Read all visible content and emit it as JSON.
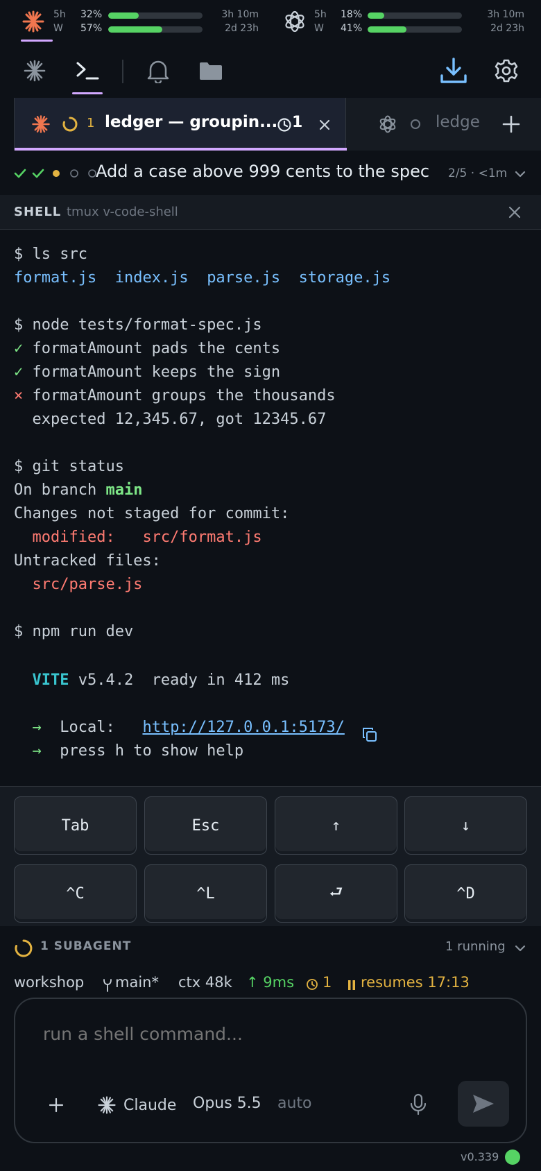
{
  "usage": {
    "claude": {
      "icon": "claude-burst-icon",
      "rows": [
        {
          "label": "5h",
          "pct": "32%",
          "fill": 0.32,
          "time": "3h 10m"
        },
        {
          "label": "W",
          "pct": "57%",
          "fill": 0.57,
          "time": "2d 23h"
        }
      ]
    },
    "openai": {
      "icon": "openai-knot-icon",
      "rows": [
        {
          "label": "5h",
          "pct": "18%",
          "fill": 0.18,
          "time": "3h 10m"
        },
        {
          "label": "W",
          "pct": "41%",
          "fill": 0.41,
          "time": "2d 23h"
        }
      ]
    }
  },
  "toolbar": {
    "left": [
      "claude-burst-icon",
      "terminal-icon",
      "bell-icon",
      "folder-icon"
    ],
    "right": [
      "download-icon",
      "gear-icon"
    ]
  },
  "tabs": [
    {
      "agent_icon": "claude-burst-icon",
      "status_icon": "spinner-icon",
      "count": "1",
      "title": "ledger — groupin...",
      "timer_count": "1"
    },
    {
      "agent_icon": "openai-knot-icon",
      "status_icon": "circle-icon",
      "title": "ledge"
    }
  ],
  "progress": {
    "task": "Add a case above 999 cents to the spec",
    "meta": "2/5 · <1m",
    "steps": [
      "done",
      "done",
      "active",
      "pending",
      "pending"
    ]
  },
  "shell": {
    "title": "SHELL",
    "subtitle": "tmux v-code-shell"
  },
  "terminal": {
    "cmd1": "$ ls src",
    "files": [
      "format.js",
      "index.js",
      "parse.js",
      "storage.js"
    ],
    "cmd2": "$ node tests/format-spec.js",
    "test_pass_mark": "✓",
    "test_fail_mark": "×",
    "tests": [
      {
        "mark": "✓",
        "text": "formatAmount pads the cents"
      },
      {
        "mark": "✓",
        "text": "formatAmount keeps the sign"
      },
      {
        "mark": "×",
        "text": "formatAmount groups the thousands"
      }
    ],
    "test_detail": "  expected 12,345.67, got 12345.67",
    "cmd3": "$ git status",
    "branch_prefix": "On branch ",
    "branch": "main",
    "changes_header": "Changes not staged for commit:",
    "modified_label": "  modified:   ",
    "modified_file": "src/format.js",
    "untracked_header": "Untracked files:",
    "untracked_file": "  src/parse.js",
    "cmd4": "$ npm run dev",
    "vite_name": "  VITE",
    "vite_rest": " v5.4.2  ready in 412 ms",
    "arrow": "  →",
    "local_label": "  Local:   ",
    "local_url": "http://127.0.0.1:5173/",
    "help_text": "  press h to show help"
  },
  "keys": [
    "Tab",
    "Esc",
    "↑",
    "↓",
    "^C",
    "^L",
    "⮐",
    "^D"
  ],
  "subagent": {
    "label": "1 SUBAGENT",
    "running": "1 running"
  },
  "status": {
    "workspace": "workshop",
    "branch": "main*",
    "ctx": "ctx 48k",
    "latency": "↑ 9ms",
    "timer": "1",
    "resumes": "resumes 17:13"
  },
  "composer": {
    "placeholder": "run a shell command...",
    "agent": "Claude",
    "model": "Opus 5.5",
    "mode": "auto"
  },
  "footer": {
    "version": "v0.339"
  },
  "colors": {
    "accent": "#d2a8ff",
    "claude": "#f0764f",
    "green": "#56d364",
    "amber": "#e3b341",
    "red": "#ff7b72",
    "blue": "#79c0ff"
  }
}
